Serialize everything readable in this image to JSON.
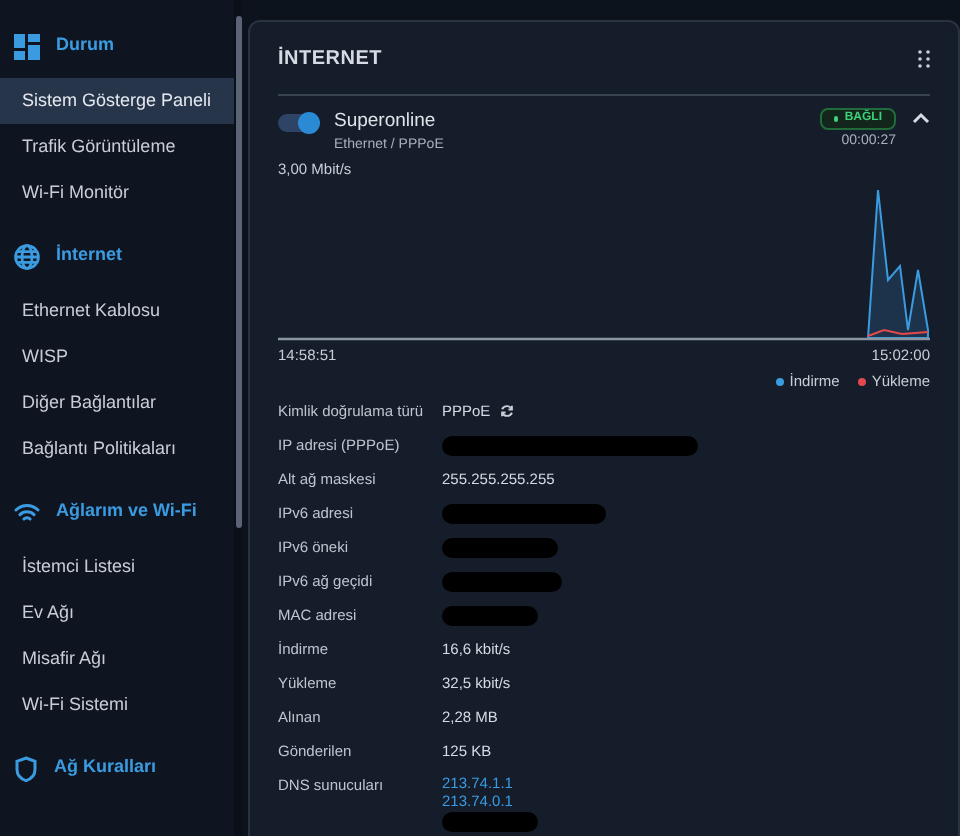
{
  "sidebar": {
    "sections": [
      {
        "title": "Durum",
        "items": [
          {
            "label": "Sistem Gösterge Paneli",
            "selected": true
          },
          {
            "label": "Trafik Görüntüleme",
            "selected": false
          },
          {
            "label": "Wi-Fi Monitör",
            "selected": false
          }
        ]
      },
      {
        "title": "İnternet",
        "items": [
          {
            "label": "Ethernet Kablosu",
            "selected": false
          },
          {
            "label": "WISP",
            "selected": false
          },
          {
            "label": "Diğer Bağlantılar",
            "selected": false
          },
          {
            "label": "Bağlantı Politikaları",
            "selected": false
          }
        ]
      },
      {
        "title": "Ağlarım ve Wi-Fi",
        "items": [
          {
            "label": "İstemci Listesi",
            "selected": false
          },
          {
            "label": "Ev Ağı",
            "selected": false
          },
          {
            "label": "Misafir Ağı",
            "selected": false
          },
          {
            "label": "Wi-Fi Sistemi",
            "selected": false
          }
        ]
      },
      {
        "title": "Ağ Kuralları"
      }
    ]
  },
  "card": {
    "title": "İNTERNET",
    "connection": {
      "name": "Superonline",
      "type": "Ethernet / PPPoE",
      "on": true,
      "status": "BAĞLI",
      "uptime": "00:00:27",
      "expanded": true
    },
    "chart": {
      "max_label": "3,00 Mbit/s",
      "start_time": "14:58:51",
      "end_time": "15:02:00",
      "legend": [
        {
          "label": "İndirme",
          "color": "#3b9be0"
        },
        {
          "label": "Yükleme",
          "color": "#e5484d"
        }
      ]
    },
    "details": [
      {
        "label": "Kimlik doğrulama türü",
        "kind": "text_refresh",
        "value": "PPPoE"
      },
      {
        "label": "IP adresi (PPPoE)",
        "kind": "redacted"
      },
      {
        "label": "Alt ağ maskesi",
        "kind": "text",
        "value": "255.255.255.255"
      },
      {
        "label": "IPv6 adresi",
        "kind": "redacted"
      },
      {
        "label": "IPv6 öneki",
        "kind": "redacted"
      },
      {
        "label": "IPv6 ağ geçidi",
        "kind": "redacted"
      },
      {
        "label": "MAC adresi",
        "kind": "redacted"
      },
      {
        "label": "İndirme",
        "kind": "text",
        "value": "16,6 kbit/s"
      },
      {
        "label": "Yükleme",
        "kind": "text",
        "value": "32,5 kbit/s"
      },
      {
        "label": "Alınan",
        "kind": "text",
        "value": "2,28 MB"
      },
      {
        "label": "Gönderilen",
        "kind": "text",
        "value": "125 KB"
      },
      {
        "label": "DNS sunucuları",
        "kind": "links",
        "values": [
          "213.74.1.1",
          "213.74.0.1"
        ]
      },
      {
        "kind": "redacted"
      }
    ]
  }
}
